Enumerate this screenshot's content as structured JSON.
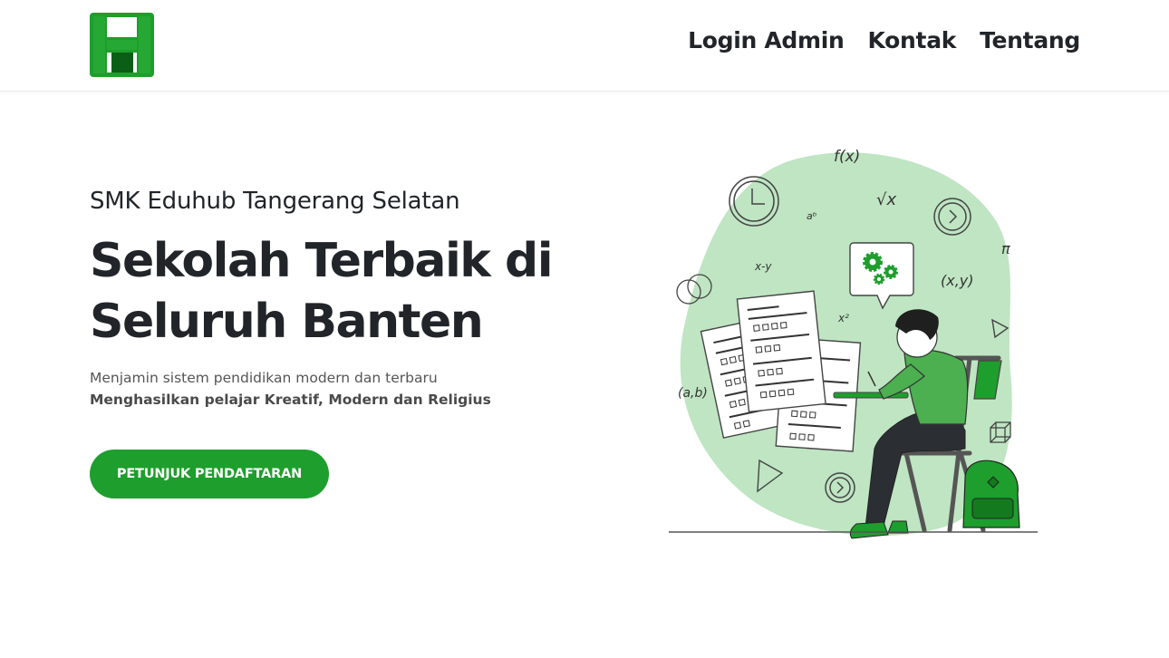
{
  "navbar": {
    "logo_icon": "eduhub-logo-icon",
    "links": [
      {
        "label": "Login Admin"
      },
      {
        "label": "Kontak"
      },
      {
        "label": "Tentang"
      }
    ]
  },
  "hero": {
    "school_name": "SMK Eduhub Tangerang Selatan",
    "headline_line1": "Sekolah Terbaik di",
    "headline_line2": "Seluruh Banten",
    "description": "Menjamin sistem pendidikan modern dan terbaru",
    "description_bold": "Menghasilkan pelajar Kreatif, Modern dan Religius",
    "cta_label": "PETUNJUK PENDAFTARAN"
  },
  "illustration": {
    "icon": "student-studying-illustration",
    "math_labels": [
      "f(x)",
      "aᵇ",
      "√x",
      "x-y",
      "x²",
      "(x,y)",
      "π",
      "(a,b)"
    ]
  },
  "colors": {
    "brand_green": "#1e9e2c",
    "dark_green": "#0b5e16",
    "blob_green": "#bfe5c3",
    "text_dark": "#212529"
  }
}
